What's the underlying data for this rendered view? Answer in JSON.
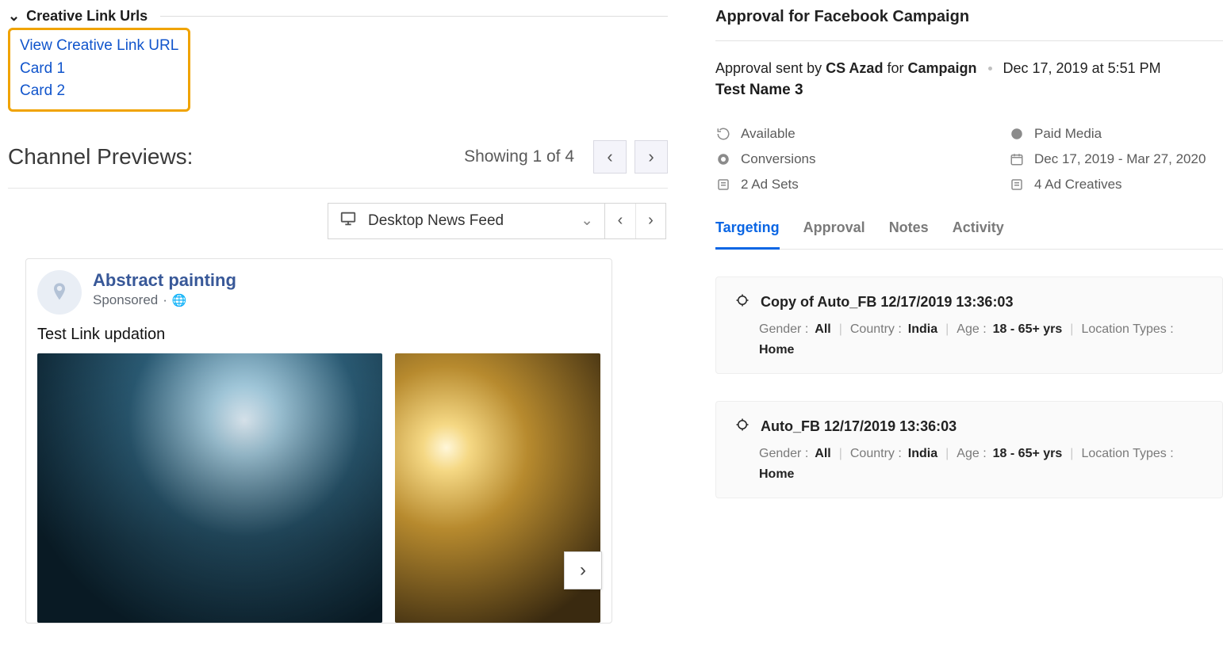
{
  "left": {
    "section_title": "Creative Link Urls",
    "links": {
      "view": "View Creative Link URL",
      "card1": "Card 1",
      "card2": "Card 2"
    },
    "channel_previews_title": "Channel Previews:",
    "showing": "Showing 1 of 4",
    "feed_select": "Desktop News Feed",
    "post": {
      "page_name": "Abstract painting",
      "sponsored": "Sponsored",
      "text": "Test Link updation"
    }
  },
  "right": {
    "title": "Approval for Facebook Campaign",
    "sent": {
      "prefix": "Approval sent by",
      "user": "CS Azad",
      "for": "for",
      "entity": "Campaign",
      "datetime": "Dec 17, 2019 at 5:51 PM"
    },
    "campaign_name": "Test Name 3",
    "meta": {
      "available": "Available",
      "paid_media": "Paid Media",
      "conversions": "Conversions",
      "dates": "Dec 17, 2019 - Mar 27, 2020",
      "adsets": "2 Ad Sets",
      "creatives": "4 Ad Creatives"
    },
    "tabs": {
      "targeting": "Targeting",
      "approval": "Approval",
      "notes": "Notes",
      "activity": "Activity"
    },
    "targets": [
      {
        "name": "Copy of Auto_FB 12/17/2019 13:36:03",
        "gender_label": "Gender :",
        "gender": "All",
        "country_label": "Country :",
        "country": "India",
        "age_label": "Age :",
        "age": "18 - 65+ yrs",
        "loc_label": "Location Types :",
        "loc": "Home"
      },
      {
        "name": "Auto_FB 12/17/2019 13:36:03",
        "gender_label": "Gender :",
        "gender": "All",
        "country_label": "Country :",
        "country": "India",
        "age_label": "Age :",
        "age": "18 - 65+ yrs",
        "loc_label": "Location Types :",
        "loc": "Home"
      }
    ]
  }
}
